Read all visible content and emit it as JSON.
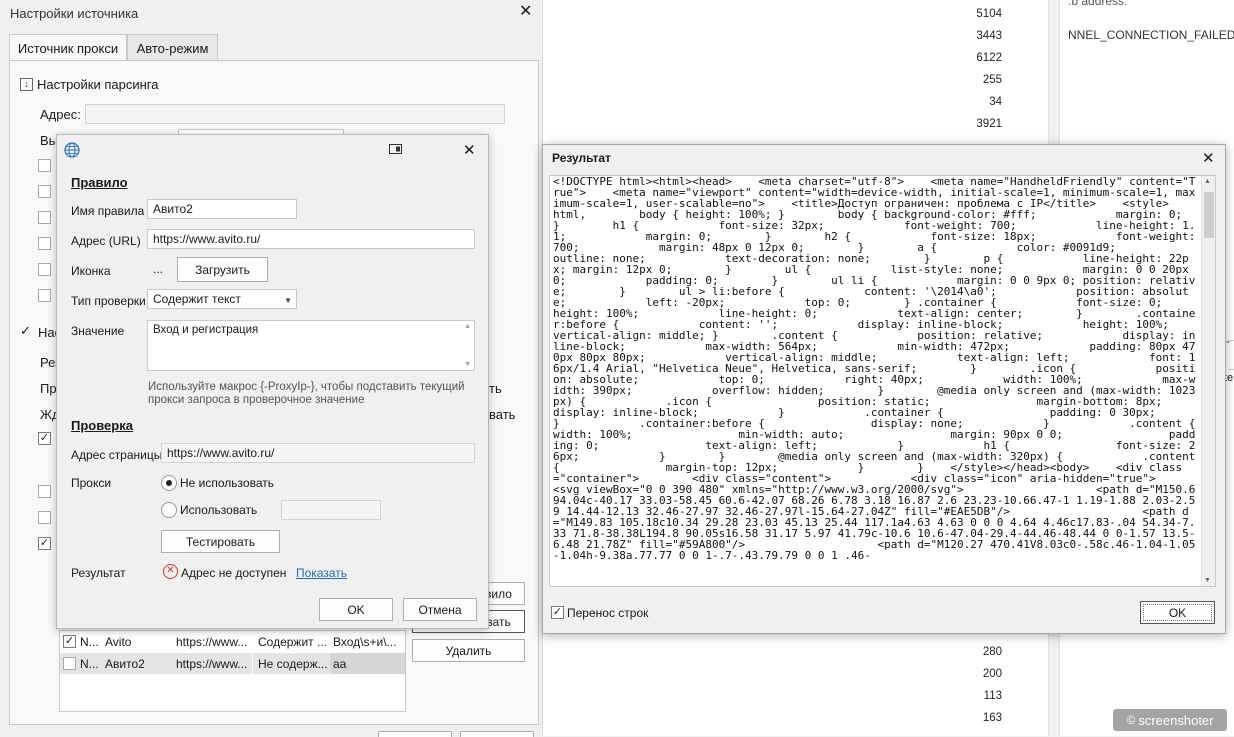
{
  "background": {
    "numbers_top": [
      "5104",
      "3443",
      "6122",
      "255",
      "34",
      "3921"
    ],
    "numbers_bottom": [
      "280",
      "200",
      "113",
      "163"
    ],
    "text_lines": [
      ".b address.",
      "NNEL_CONNECTION_FAILED"
    ],
    "right_fragments": [
      "-",
      "te"
    ],
    "watermark": "screenshoter"
  },
  "main_dialog": {
    "title": "Настройки источника",
    "tabs": [
      {
        "label": "Источник прокси"
      },
      {
        "label": "Авто-режим"
      }
    ],
    "parsing_section": "Настройки парсинга",
    "address_label": "Адрес:",
    "partial_labels": {
      "vy": "Вы",
      "nas": "Нас",
      "rez": "Рез",
      "pr": "Пр",
      "zhd": "Жд",
      "vilo": "вило",
      "vat": "вать",
      "right_edge": "ть"
    },
    "delete_button": "Удалить",
    "table": {
      "rows": [
        {
          "checked": true,
          "c1": "N...",
          "c2": "Avito",
          "c3": "https://www...",
          "c4": "Содержит ...",
          "c5": "Вход\\s+и\\..."
        },
        {
          "checked": false,
          "c1": "N...",
          "c2": "Авито2",
          "c3": "https://www...",
          "c4": "Не содерж...",
          "c5": "aa"
        }
      ]
    }
  },
  "rule_dialog": {
    "section_rule": "Правило",
    "name_label": "Имя правила",
    "name_value": "Авито2",
    "url_label": "Адрес (URL)",
    "url_value": "https://www.avito.ru/",
    "icon_label": "Иконка",
    "icon_dots": "...",
    "upload_button": "Загрузить",
    "check_type_label": "Тип проверки",
    "check_type_value": "Содержит текст",
    "value_label": "Значение",
    "value_text": "Вход и регистрация",
    "hint": "Используйте макрос {-ProxyIp-}, чтобы подставить текущий прокси запроса в проверочное значение",
    "section_check": "Проверка",
    "page_addr_label": "Адрес страницы",
    "page_addr_value": "https://www.avito.ru/",
    "proxy_label": "Прокси",
    "radio_no": "Не использовать",
    "radio_use": "Использовать",
    "test_button": "Тестировать",
    "result_label": "Результат",
    "result_status": "Адрес не доступен",
    "show_link": "Показать",
    "ok_button": "OK",
    "cancel_button": "Отмена"
  },
  "result_dialog": {
    "title": "Результат",
    "wrap_label": "Перенос строк",
    "wrap_checked": true,
    "ok_button": "OK",
    "code": "<!DOCTYPE html><html><head>    <meta charset=\"utf-8\">    <meta name=\"HandheldFriendly\" content=\"True\">    <meta name=\"viewport\" content=\"width=device-width, initial-scale=1, minimum-scale=1, maximum-scale=1, user-scalable=no\">    <title>Доступ ограничен: проблема с IP</title>    <style>        html,        body { height: 100%; }        body { background-color: #fff;            margin: 0;        }        h1 {            font-size: 32px;            font-weight: 700;            line-height: 1.1;            margin: 0;        }        h2 {            font-size: 18px;            font-weight: 700;            margin: 48px 0 12px 0;        }        a {            color: #0091d9;            outline: none;            text-decoration: none;        }        p {            line-height: 22px; margin: 12px 0;        }        ul {            list-style: none;            margin: 0 0 20px 0;            padding: 0;        }        ul li {            margin: 0 0 9px 0; position: relative;        }        ul > li:before {            content: '\\2014\\a0';            position: absolute;            left: -20px;            top: 0;        } .container {            font-size: 0;            height: 100%;            line-height: 0;            text-align: center;        }        .container:before {            content: '';            display: inline-block;            height: 100%;            vertical-align: middle; }        .content {            position: relative;            display: inline-block;            max-width: 564px;            min-width: 472px;            padding: 80px 470px 80px 80px;            vertical-align: middle;            text-align: left;            font: 16px/1.4 Arial, \"Helvetica Neue\", Helvetica, sans-serif;        }        .icon {            position: absolute;            top: 0;            right: 40px;            width: 100%;            max-width: 390px;            overflow: hidden;        }        @media only screen and (max-width: 1023px) {            .icon {                position: static;                margin-bottom: 8px;                display: inline-block;            }            .container {                padding: 0 30px;            }            .container:before {                display: none;            }            .content {                width: 100%;                min-width: auto;                margin: 90px 0 0;                padding: 0;                text-align: left;            }            h1 {                font-size: 26px;            }        }        @media only screen and (max-width: 320px) {            .content {                margin-top: 12px;            }        }    </style></head><body>    <div class=\"container\">        <div class=\"content\">            <div class=\"icon\" aria-hidden=\"true\">                <svg viewBox=\"0 0 390 480\" xmlns=\"http://www.w3.org/2000/svg\">                    <path d=\"M150.6 94.04c-40.17 33.03-58.45 60.6-42.07 68.26 6.78 3.18 16.87 2.6 23.23-10.66.47-1 1.19-1.88 2.03-2.59 14.44-12.13 32.46-27.97 32.46-27.97l-15.64-27.04Z\" fill=\"#EAE5DB\"/>                    <path d=\"M149.83 105.18c10.34 29.28 23.03 45.13 25.44 117.1a4.63 4.63 0 0 0 4.64 4.46c17.83-.04 54.34-7.33 71.8-38.38L194.8 90.05s16.58 31.17 5.97 41.79c-10.6 10.6-47.04-29.4-44.46-48.44 0 0-1.57 13.5-6.48 21.78Z\" fill=\"#59A800\"/>                    <path d=\"M120.27 470.41V8.03c0-.58c.46-1.04-1.05-1.04h-9.38a.77.77 0 0 1-.7-.43.79.79 0 0 1 .46-"
  }
}
